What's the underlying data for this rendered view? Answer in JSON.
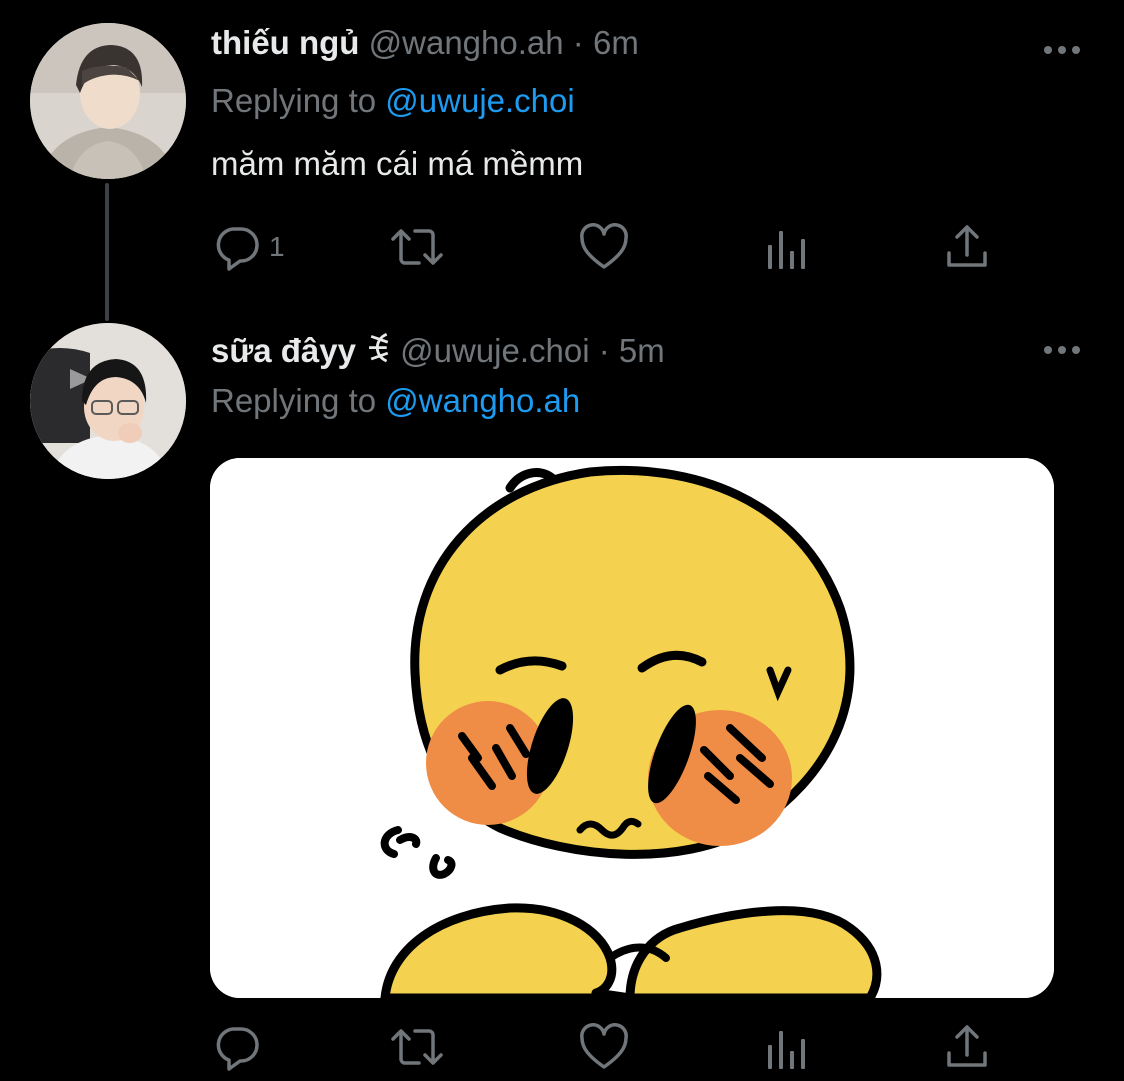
{
  "tweets": [
    {
      "name": "thiếu ngủ",
      "handle": "@wangho.ah",
      "separator": "·",
      "time": "6m",
      "replying_prefix": "Replying to",
      "replying_to": "@uwuje.choi",
      "text": "măm măm cái má mềmm",
      "reply_count": "1"
    },
    {
      "name": "sữa đâyy ꉂ",
      "handle": "@uwuje.choi",
      "separator": "·",
      "time": "5m",
      "replying_prefix": "Replying to",
      "replying_to": "@wangho.ah",
      "media": "blushing-cursed-emoji-image"
    }
  ],
  "colors": {
    "background": "#000000",
    "primary_text": "#e7e9ea",
    "secondary_text": "#71767b",
    "link": "#1d9bf0",
    "thread_line": "#3e4144",
    "emoji_yellow": "#f4d24f",
    "blush": "#ef8c45"
  },
  "icons": {
    "actions": [
      "reply-icon",
      "retweet-icon",
      "like-icon",
      "analytics-icon",
      "share-icon"
    ],
    "more": "more-icon"
  }
}
